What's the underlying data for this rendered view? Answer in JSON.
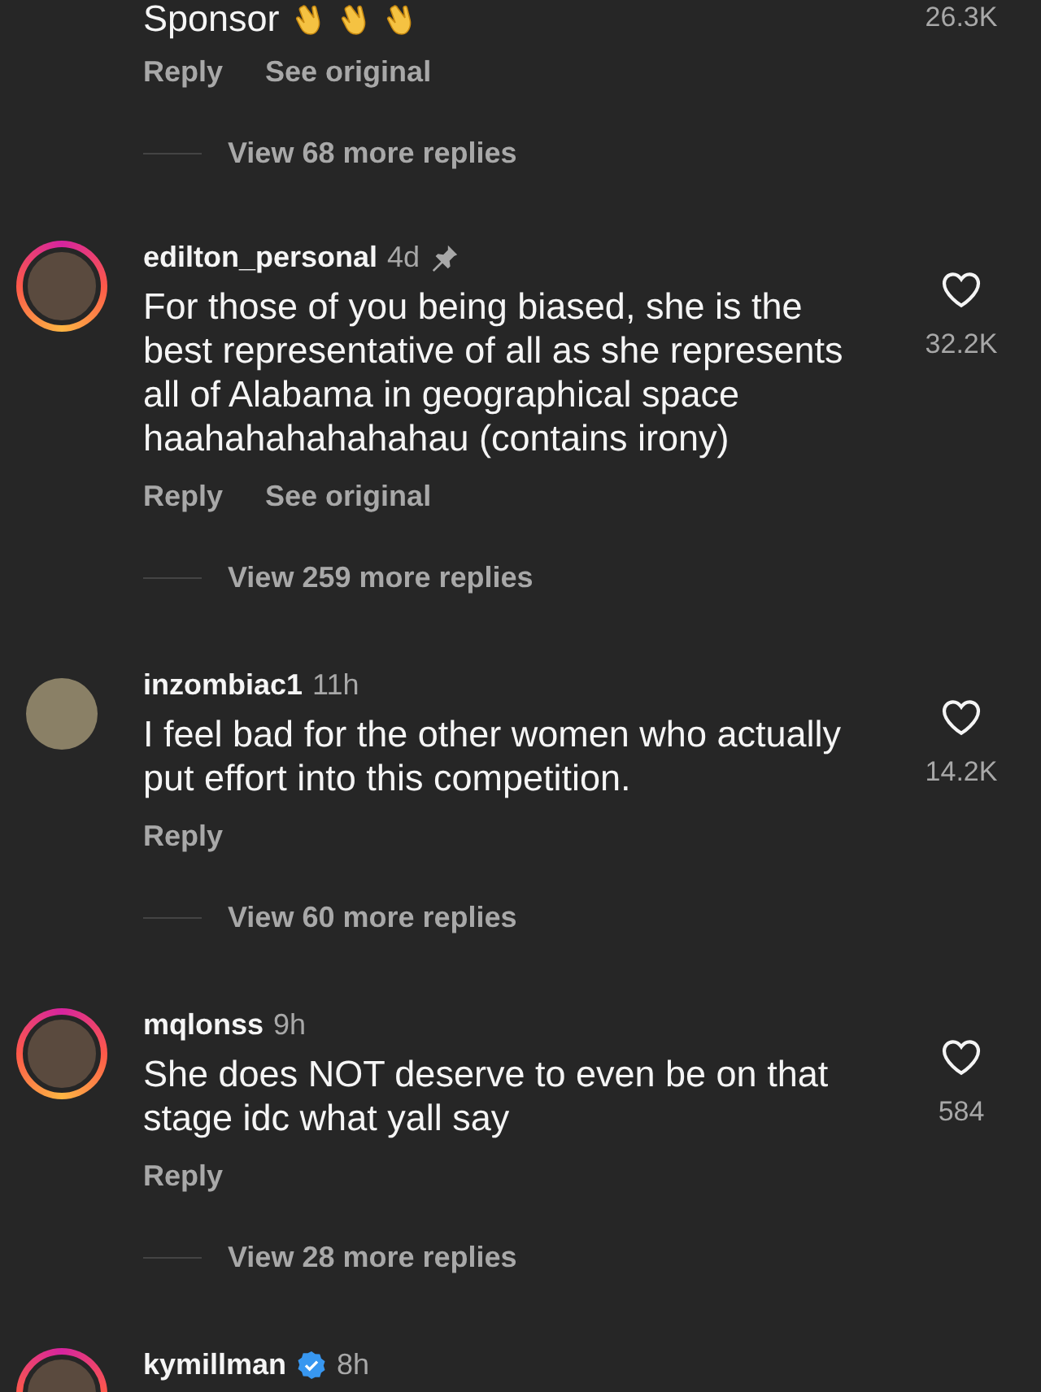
{
  "comments": [
    {
      "kind": "cut_top",
      "text": "Sponsor",
      "likes": "26.3K",
      "actions": [
        "Reply",
        "See original"
      ],
      "view_replies": "View 68 more replies"
    },
    {
      "kind": "full",
      "username": "edilton_personal",
      "time": "4d",
      "text": "For those of you being biased, she is the best representative of all as she represents all of Alabama in geographical space haahahahahahahau (contains irony)",
      "likes": "32.2K",
      "heart": true,
      "story_ring": true,
      "pinned": true,
      "verified": false,
      "actions": [
        "Reply",
        "See original"
      ],
      "view_replies": "View 259 more replies"
    },
    {
      "kind": "full",
      "username": "inzombiac1",
      "time": "11h",
      "text": "I feel bad for the other women who actually put effort into this competition.",
      "likes": "14.2K",
      "heart": true,
      "story_ring": false,
      "pinned": false,
      "verified": false,
      "actions": [
        "Reply"
      ],
      "view_replies": "View 60 more replies"
    },
    {
      "kind": "full",
      "username": "mqlonss",
      "time": "9h",
      "text": "She does NOT deserve to even be on that stage idc what yall say",
      "likes": "584",
      "heart": true,
      "story_ring": true,
      "pinned": false,
      "verified": false,
      "actions": [
        "Reply"
      ],
      "view_replies": "View 28 more replies"
    },
    {
      "kind": "cut_bottom",
      "username": "kymillman",
      "time": "8h",
      "story_ring": true,
      "pinned": false,
      "verified": true
    }
  ]
}
